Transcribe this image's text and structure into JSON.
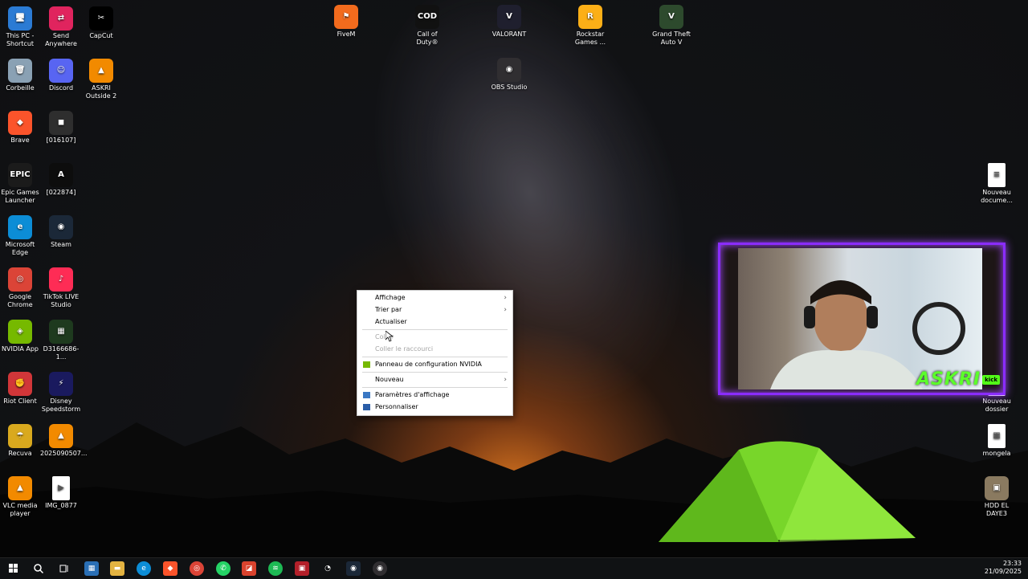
{
  "desktop": {
    "icons_left": [
      {
        "label": "This PC - Shortcut",
        "name": "this-pc-icon",
        "color": "#2b7bd4",
        "glyph": "🖥"
      },
      {
        "label": "Send Anywhere",
        "name": "send-anywhere-icon",
        "color": "#e0245e",
        "glyph": "⇄"
      },
      {
        "label": "CapCut",
        "name": "capcut-icon",
        "color": "#000000",
        "glyph": "✂"
      },
      {
        "label": "Corbeille",
        "name": "recycle-bin-icon",
        "color": "#8aa1b4",
        "glyph": "🗑"
      },
      {
        "label": "Discord",
        "name": "discord-icon",
        "color": "#5865f2",
        "glyph": "☺"
      },
      {
        "label": "ASKRI Outside 2",
        "name": "vlc-icon",
        "color": "#f28a00",
        "glyph": "▲"
      },
      {
        "label": "Brave",
        "name": "brave-icon",
        "color": "#fb542b",
        "glyph": "◆"
      },
      {
        "label": "[016107]",
        "name": "game-shortcut-icon",
        "color": "#2e2e2e",
        "glyph": "◼"
      },
      {
        "label": "Epic Games Launcher",
        "name": "epic-games-icon",
        "color": "#1b1b1b",
        "glyph": "EPIC"
      },
      {
        "label": "[022874]",
        "name": "askri-shortcut-icon",
        "color": "#0d0d0d",
        "glyph": "A"
      },
      {
        "label": "Microsoft Edge",
        "name": "edge-icon",
        "color": "#0c8dd6",
        "glyph": "e"
      },
      {
        "label": "Steam",
        "name": "steam-icon",
        "color": "#1b2838",
        "glyph": "◉"
      },
      {
        "label": "Google Chrome",
        "name": "chrome-icon",
        "color": "#db4437",
        "glyph": "◎"
      },
      {
        "label": "TikTok LIVE Studio",
        "name": "tiktok-icon",
        "color": "#fe2c55",
        "glyph": "♪"
      },
      {
        "label": "NVIDIA App",
        "name": "nvidia-icon",
        "color": "#76b900",
        "glyph": "◈"
      },
      {
        "label": "D3166686-1...",
        "name": "file-shortcut-icon",
        "color": "#1e3a1e",
        "glyph": "▦"
      },
      {
        "label": "Riot Client",
        "name": "riot-icon",
        "color": "#d13639",
        "glyph": "✊"
      },
      {
        "label": "Disney Speedstorm",
        "name": "speedstorm-icon",
        "color": "#1a1a5e",
        "glyph": "⚡"
      },
      {
        "label": "Recuva",
        "name": "recuva-icon",
        "color": "#d9a91e",
        "glyph": "☂"
      },
      {
        "label": "2025090507...",
        "name": "vlc-file-icon",
        "color": "#f28a00",
        "glyph": "▲"
      },
      {
        "label": "VLC media player",
        "name": "vlc-player-icon",
        "color": "#f28a00",
        "glyph": "▲"
      },
      {
        "label": "IMG_0877",
        "name": "image-file-icon",
        "color": "#ffffff",
        "glyph": "▶"
      }
    ],
    "icons_top": [
      {
        "label": "FiveM",
        "name": "fivem-icon",
        "color": "#f26b1d",
        "glyph": "⚑"
      },
      {
        "label": "Call of Duty®",
        "name": "cod-icon",
        "color": "#111111",
        "glyph": "COD"
      },
      {
        "label": "VALORANT",
        "name": "valorant-icon",
        "color": "#1f1f2e",
        "glyph": "V"
      },
      {
        "label": "Rockstar Games ...",
        "name": "rockstar-icon",
        "color": "#fcaf17",
        "glyph": "R"
      },
      {
        "label": "Grand Theft Auto V",
        "name": "gta-icon",
        "color": "#2d4a2d",
        "glyph": "V"
      },
      {
        "label": "OBS Studio",
        "name": "obs-icon",
        "color": "#302e31",
        "glyph": "◉"
      }
    ],
    "icons_right": [
      {
        "label": "Nouveau docume...",
        "name": "text-document-icon",
        "color": "#ffffff",
        "glyph": "≡"
      },
      {
        "label": "Nouveau dossier",
        "name": "new-folder-icon",
        "color": "#ffffff",
        "glyph": "≡"
      },
      {
        "label": "mongela",
        "name": "mongela-file-icon",
        "color": "#ffffff",
        "glyph": "▦"
      },
      {
        "label": "HDD EL DAYE3",
        "name": "hdd-file-icon",
        "color": "#8a7a60",
        "glyph": "▣"
      }
    ]
  },
  "context_menu": {
    "affichage": "Affichage",
    "trier_par": "Trier par",
    "actualiser": "Actualiser",
    "coller": "Coller",
    "coller_raccourci": "Coller le raccourci",
    "nvidia": "Panneau de configuration NVIDIA",
    "nouveau": "Nouveau",
    "parametres": "Paramètres d'affichage",
    "personnaliser": "Personnaliser"
  },
  "webcam": {
    "brand": "ASKRI",
    "badge": "kick"
  },
  "taskbar": {
    "time": "23:33",
    "date": "21/09/2025"
  },
  "colors": {
    "accent": "#8a2cff",
    "brand_green": "#5cff2a"
  }
}
